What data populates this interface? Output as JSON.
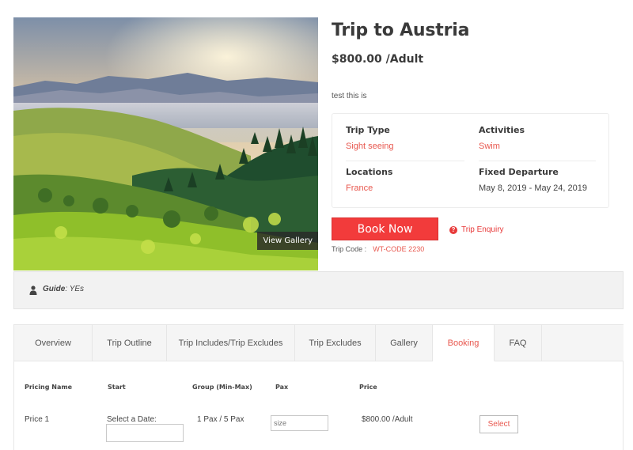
{
  "gallery": {
    "view_label": "View Gallery"
  },
  "trip": {
    "title": "Trip to Austria",
    "price": "$800.00 /Adult",
    "description": "test this is",
    "info": {
      "trip_type_label": "Trip Type",
      "trip_type_value": "Sight seeing",
      "activities_label": "Activities",
      "activities_value": "Swim",
      "locations_label": "Locations",
      "locations_value": "France",
      "fixed_departure_label": "Fixed Departure",
      "fixed_departure_value": "May 8, 2019 - May 24, 2019"
    },
    "book_label": "Book Now",
    "enquiry_label": "Trip Enquiry",
    "code_label": "Trip Code :",
    "code_value": "WT-CODE 2230"
  },
  "guide": {
    "label": "Guide",
    "value": ": YEs"
  },
  "tabs": [
    {
      "label": "Overview",
      "active": false
    },
    {
      "label": "Trip Outline",
      "active": false
    },
    {
      "label": "Trip Includes/Trip Excludes",
      "active": false
    },
    {
      "label": "Trip Excludes",
      "active": false
    },
    {
      "label": "Gallery",
      "active": false
    },
    {
      "label": "Booking",
      "active": true
    },
    {
      "label": "FAQ",
      "active": false
    }
  ],
  "booking": {
    "headers": {
      "pricing_name": "Pricing Name",
      "start": "Start",
      "group": "Group (Min-Max)",
      "pax": "Pax",
      "price": "Price"
    },
    "row": {
      "name": "Price 1",
      "start_label": "Select a Date:",
      "group": "1 Pax / 5 Pax",
      "pax_placeholder": "size",
      "price": "$800.00 /Adult",
      "select_label": "Select"
    }
  },
  "colors": {
    "accent": "#e8574e",
    "button": "#f23b3b"
  },
  "icons": {
    "enquiry": "question-circle-icon",
    "guide": "person-icon"
  }
}
